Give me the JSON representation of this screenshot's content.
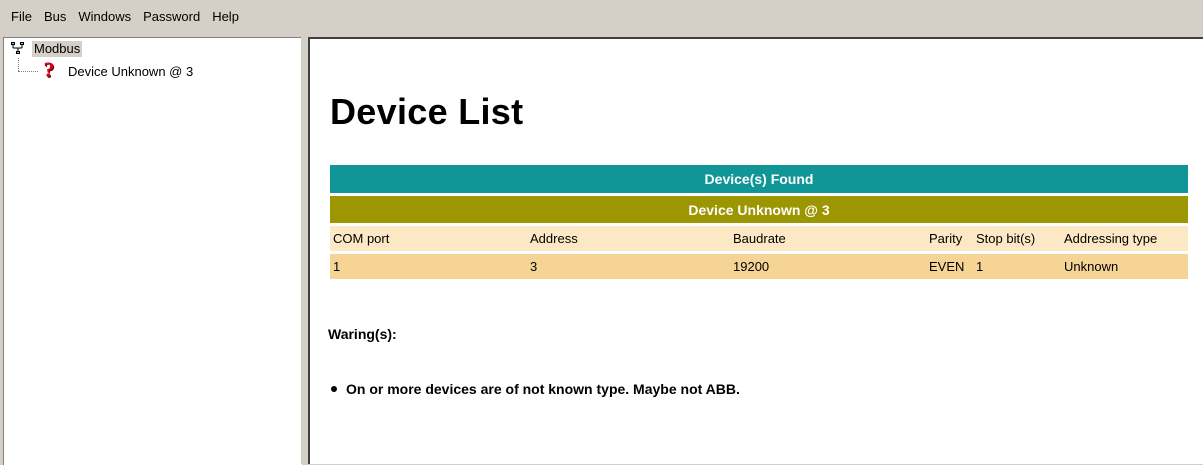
{
  "menu": [
    "File",
    "Bus",
    "Windows",
    "Password",
    "Help"
  ],
  "tree": {
    "root": {
      "label": "Modbus",
      "icon": "network-icon"
    },
    "children": [
      {
        "label": "Device Unknown @ 3",
        "icon": "question-mark-icon"
      }
    ]
  },
  "content": {
    "title": "Device List",
    "found_header": "Device(s) Found",
    "device_header": "Device Unknown @ 3",
    "columns": [
      "COM port",
      "Address",
      "Baudrate",
      "Parity",
      "Stop bit(s)",
      "Addressing type"
    ],
    "values": [
      "1",
      "3",
      "19200",
      "EVEN",
      "1",
      "Unknown"
    ],
    "warnings_title": "Waring(s):",
    "warnings": [
      "On or more devices are of not known type. Maybe not ABB."
    ]
  },
  "colors": {
    "found_header_bg": "#109696",
    "device_header_bg": "#9c9600",
    "column_header_bg": "#fde8c6",
    "value_row_bg": "#f6d496",
    "error_icon": "#d2001e"
  }
}
